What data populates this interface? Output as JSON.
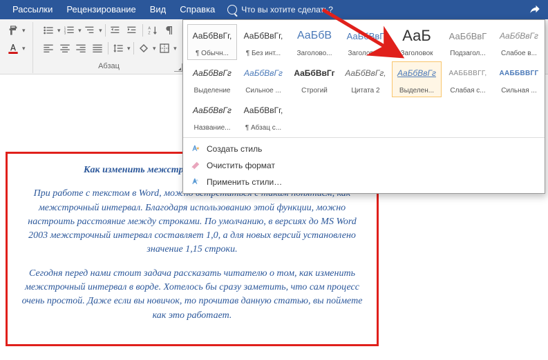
{
  "topbar": {
    "items": [
      "Рассылки",
      "Рецензирование",
      "Вид",
      "Справка"
    ],
    "tell_me": "Что вы хотите сделать?"
  },
  "ribbon": {
    "paragraph_label": "Абзац"
  },
  "styles": {
    "row1": [
      {
        "preview": "АаБбВвГг,",
        "label": "¶ Обычн...",
        "pstyle": "font-size:12px;color:#333"
      },
      {
        "preview": "АаБбВвГг,",
        "label": "¶ Без инт...",
        "pstyle": "font-size:12px;color:#333"
      },
      {
        "preview": "АаБбВ",
        "label": "Заголово...",
        "pstyle": "font-size:16px;color:#4a79b8"
      },
      {
        "preview": "АаБбВвГ",
        "label": "Заголово...",
        "pstyle": "font-size:13px;color:#4a79b8"
      },
      {
        "preview": "АаБ",
        "label": "Заголовок",
        "pstyle": "font-size:22px;color:#333;font-weight:300"
      },
      {
        "preview": "АаБбВвГ",
        "label": "Подзагол...",
        "pstyle": "font-size:13px;color:#888"
      },
      {
        "preview": "АаБбВвГг",
        "label": "Слабое в...",
        "pstyle": "font-size:12px;color:#888;font-style:italic"
      }
    ],
    "row2": [
      {
        "preview": "АаБбВвГг",
        "label": "Выделение",
        "pstyle": "font-size:12px;color:#333;font-style:italic"
      },
      {
        "preview": "АаБбВвГг",
        "label": "Сильное ...",
        "pstyle": "font-size:12px;color:#4a79b8;font-style:italic"
      },
      {
        "preview": "АаБбВвГг",
        "label": "Строгий",
        "pstyle": "font-size:12px;color:#333;font-weight:bold"
      },
      {
        "preview": "АаБбВвГг,",
        "label": "Цитата 2",
        "pstyle": "font-size:12px;color:#666;font-style:italic"
      },
      {
        "preview": "АаБбВвГг",
        "label": "Выделен...",
        "pstyle": "font-size:12px;color:#4a79b8;font-style:italic;text-decoration:underline"
      },
      {
        "preview": "ААББВВГГ,",
        "label": "Слабая с...",
        "pstyle": "font-size:10px;color:#888;letter-spacing:0.3px"
      },
      {
        "preview": "ААББВВГГ",
        "label": "Сильная ...",
        "pstyle": "font-size:10px;color:#4a79b8;font-weight:bold;letter-spacing:0.3px"
      }
    ],
    "row3": [
      {
        "preview": "АаБбВвГг",
        "label": "Название...",
        "pstyle": "font-size:12px;color:#333;font-style:italic"
      },
      {
        "preview": "АаБбВвГг,",
        "label": "¶ Абзац с...",
        "pstyle": "font-size:12px;color:#333"
      }
    ]
  },
  "gallery_menu": {
    "create": "Создать стиль",
    "clear": "Очистить формат",
    "apply": "Применить стили…"
  },
  "document": {
    "title": "Как изменить межстр",
    "p1": "При работе с текстом в Word, можно встретиться с таким понятием, как межстрочный интервал. Благодаря использованию этой функции, можно настроить расстояние между строками. По умолчанию, в версиях до MS Word 2003 межстрочный интервал составляет 1,0, а для новых версий установлено значение 1,15 строки.",
    "p2": "Сегодня перед нами стоит задача рассказать читателю о том, как изменить межстрочный интервал в ворде. Хотелось бы сразу заметить, что сам процесс очень простой. Даже если вы новичок, то прочитав данную статью, вы поймете как это работает."
  }
}
